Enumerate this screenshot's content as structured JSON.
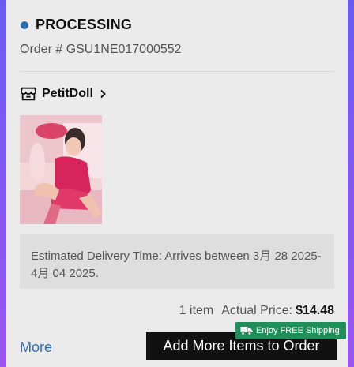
{
  "order": {
    "status": "PROCESSING",
    "order_number": "Order # GSU1NE017000552"
  },
  "store": {
    "name": "PetitDoll",
    "icon": "store-icon"
  },
  "delivery": {
    "text": "Estimated Delivery Time: Arrives between 3月 28 2025-4月 04 2025."
  },
  "summary": {
    "item_count": "1 item",
    "price_label": "Actual Price:",
    "price_value": "$14.48"
  },
  "actions": {
    "more_label": "More",
    "add_items_label": "Add More Items to Order",
    "shipping_badge": "Enjoy FREE Shipping"
  },
  "colors": {
    "status_dot": "#2f6eb5",
    "link": "#2f6eb5",
    "badge": "#1f8f5a",
    "button": "#111111"
  }
}
